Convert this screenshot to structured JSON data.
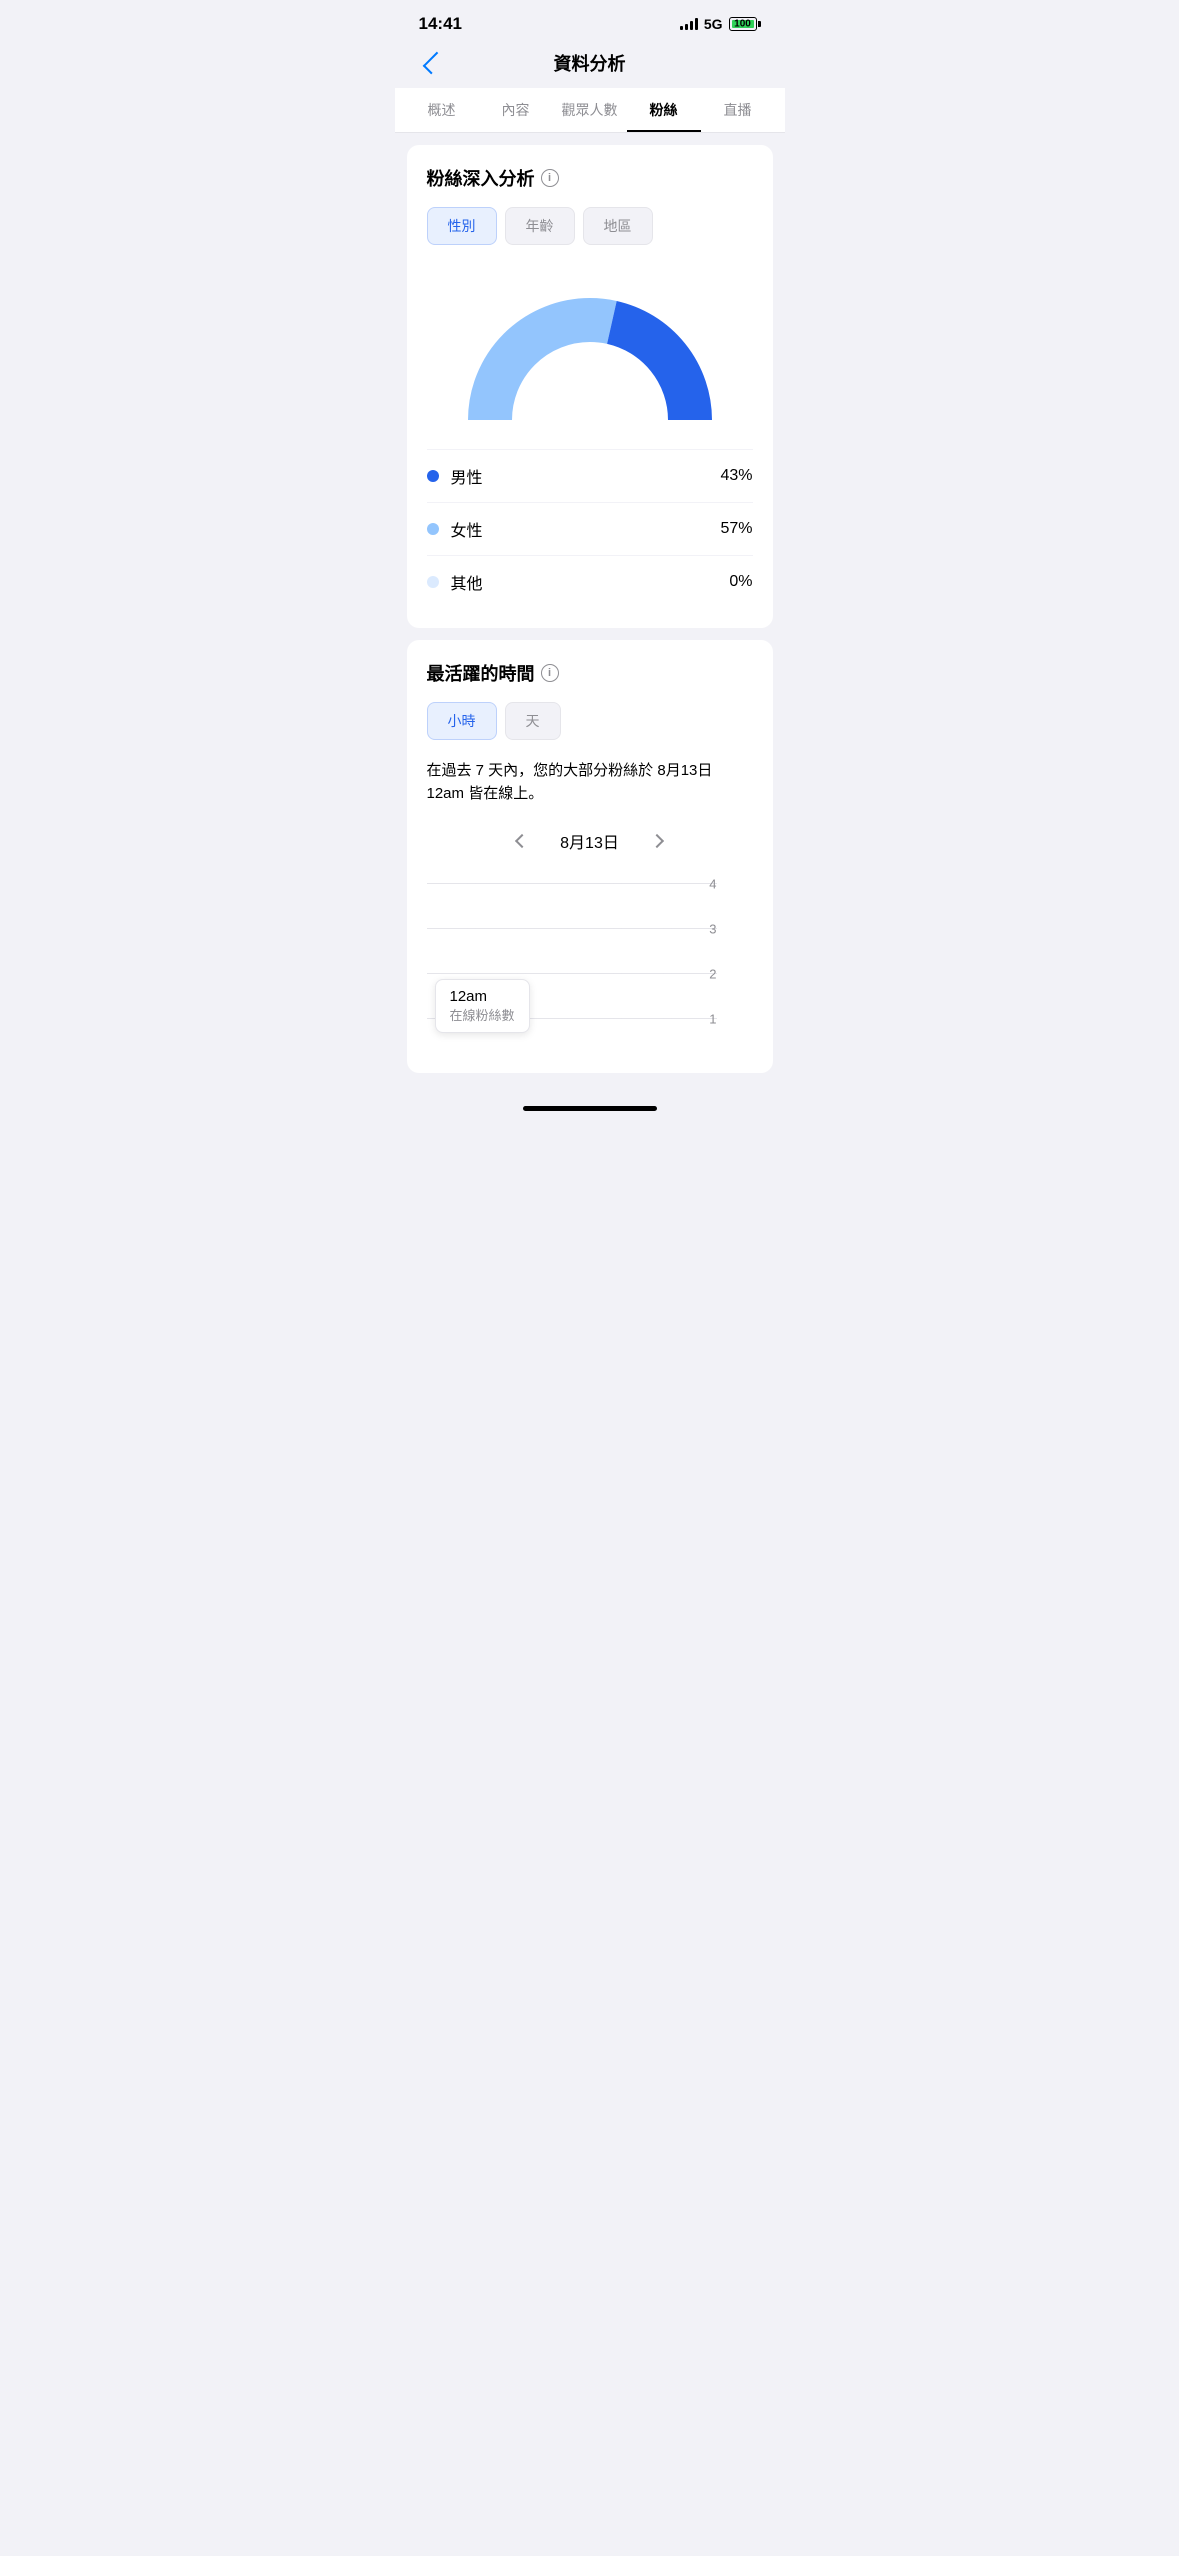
{
  "statusBar": {
    "time": "14:41",
    "network": "5G",
    "battery": "100"
  },
  "header": {
    "title": "資料分析",
    "backLabel": "返回"
  },
  "tabs": [
    {
      "id": "overview",
      "label": "概述",
      "active": false
    },
    {
      "id": "content",
      "label": "內容",
      "active": false
    },
    {
      "id": "audience",
      "label": "觀眾人數",
      "active": false
    },
    {
      "id": "fans",
      "label": "粉絲",
      "active": true
    },
    {
      "id": "live",
      "label": "直播",
      "active": false
    }
  ],
  "fansAnalysis": {
    "title": "粉絲深入分析",
    "filters": [
      {
        "id": "gender",
        "label": "性別",
        "active": true
      },
      {
        "id": "age",
        "label": "年齡",
        "active": false
      },
      {
        "id": "region",
        "label": "地區",
        "active": false
      }
    ],
    "chart": {
      "male": 43,
      "female": 57,
      "other": 0,
      "maleColor": "#2563eb",
      "femaleColor": "#93c5fd",
      "otherColor": "#dbeafe"
    },
    "legend": [
      {
        "id": "male",
        "label": "男性",
        "value": "43%",
        "color": "#2563eb"
      },
      {
        "id": "female",
        "label": "女性",
        "value": "57%",
        "color": "#93c5fd"
      },
      {
        "id": "other",
        "label": "其他",
        "value": "0%",
        "color": "#dbeafe"
      }
    ]
  },
  "activeTime": {
    "title": "最活躍的時間",
    "filters": [
      {
        "id": "hour",
        "label": "小時",
        "active": true
      },
      {
        "id": "day",
        "label": "天",
        "active": false
      }
    ],
    "description": "在過去 7 天內，您的大部分粉絲於 8月13日 12am 皆在線上。",
    "currentDate": "8月13日",
    "yAxisMax": 4,
    "tooltip": {
      "time": "12am",
      "countLabel": "在線粉絲數"
    }
  }
}
